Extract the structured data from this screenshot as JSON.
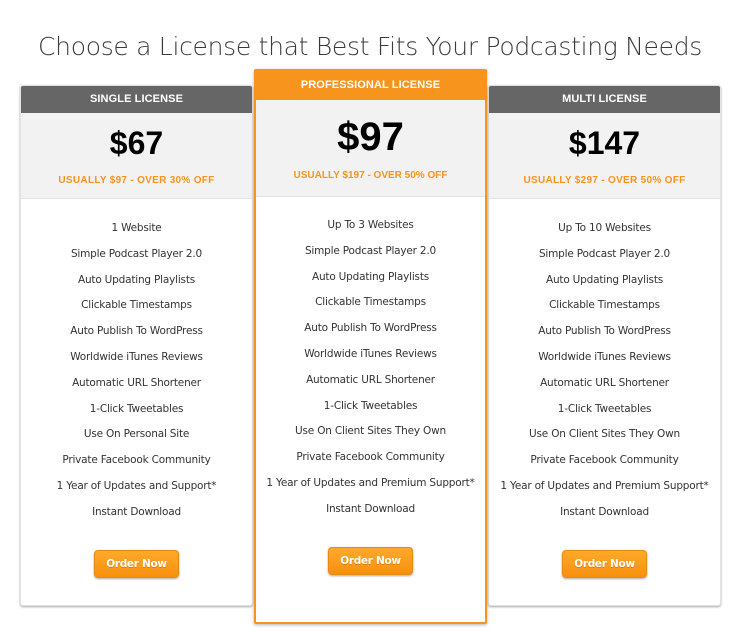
{
  "page": {
    "title": "Choose a License that Best Fits Your Podcasting Needs"
  },
  "colors": {
    "accent": "#f7941d",
    "header_gray": "#666666",
    "price_panel_bg": "#f2f2f2"
  },
  "plans": [
    {
      "name": "SINGLE LICENSE",
      "price": "$67",
      "discount": "USUALLY $97 - OVER 30% OFF",
      "featured": false,
      "features": [
        "1 Website",
        "Simple Podcast Player 2.0",
        "Auto Updating Playlists",
        "Clickable Timestamps",
        "Auto Publish To WordPress",
        "Worldwide iTunes Reviews",
        "Automatic URL Shortener",
        "1-Click Tweetables",
        "Use On Personal Site",
        "Private Facebook Community",
        "1 Year of Updates and Support*",
        "Instant Download"
      ],
      "button_label": "Order Now"
    },
    {
      "name": "PROFESSIONAL LICENSE",
      "price": "$97",
      "discount": "USUALLY $197 - OVER 50% OFF",
      "featured": true,
      "features": [
        "Up To 3 Websites",
        "Simple Podcast Player 2.0",
        "Auto Updating Playlists",
        "Clickable Timestamps",
        "Auto Publish To WordPress",
        "Worldwide iTunes Reviews",
        "Automatic URL Shortener",
        "1-Click Tweetables",
        "Use On Client Sites They Own",
        "Private Facebook Community",
        "1 Year of Updates and Premium Support*",
        "Instant Download"
      ],
      "button_label": "Order Now"
    },
    {
      "name": "MULTI LICENSE",
      "price": "$147",
      "discount": "USUALLY $297 - OVER 50% OFF",
      "featured": false,
      "features": [
        "Up To 10 Websites",
        "Simple Podcast Player 2.0",
        "Auto Updating Playlists",
        "Clickable Timestamps",
        "Auto Publish To WordPress",
        "Worldwide iTunes Reviews",
        "Automatic URL Shortener",
        "1-Click Tweetables",
        "Use On Client Sites They Own",
        "Private Facebook Community",
        "1 Year of Updates and Premium Support*",
        "Instant Download"
      ],
      "button_label": "Order Now"
    }
  ]
}
